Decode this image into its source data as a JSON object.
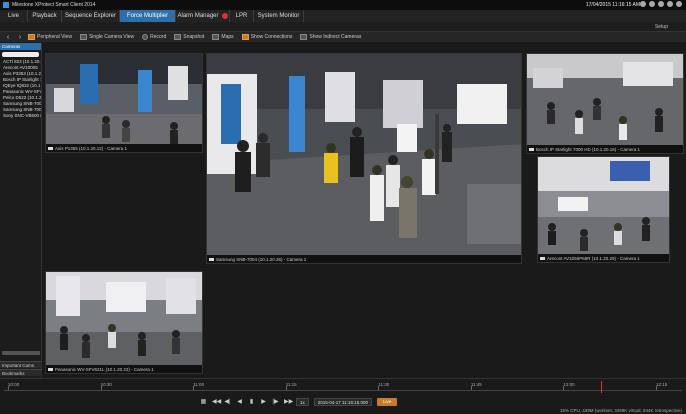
{
  "window": {
    "title": "Milestone XProtect Smart Client 2014",
    "clock": "17/04/2015 11:16:15 AM"
  },
  "tabs": [
    {
      "label": "Live",
      "active": false,
      "badge": false
    },
    {
      "label": "Playback",
      "active": false,
      "badge": false
    },
    {
      "label": "Sequence Explorer",
      "active": false,
      "badge": false
    },
    {
      "label": "Force Multiplier",
      "active": true,
      "badge": false
    },
    {
      "label": "Alarm Manager",
      "active": false,
      "badge": true
    },
    {
      "label": "LPR",
      "active": false,
      "badge": false
    },
    {
      "label": "System Monitor",
      "active": false,
      "badge": false
    }
  ],
  "subbar": {
    "setup_label": "Setup"
  },
  "toolbar": {
    "back": "‹",
    "forward": "›",
    "peripheral_view": "Peripheral View",
    "single_camera_view": "Single Camera View",
    "record": "Record",
    "snapshot": "Snapshot",
    "maps": "Maps",
    "show_connections": "Show Connections",
    "show_indirect": "Show Indirect Cameras"
  },
  "sidebar": {
    "header": "Cameras",
    "items": [
      "ACTi 823 (10.1.20.3",
      "Arecont AV10005",
      "Axis P3353 (10.1.2",
      "Bosch IP Starlight 7",
      "IQEye IQ832 (10.1",
      "Panasonic WV-SFV",
      "Pelco D522 (10.1.20",
      "Samsung SNB-7004",
      "Samsung SNB-7004",
      "Sony SNC-VB600 (1"
    ],
    "important_cams": "Important Cams",
    "bookmarks": "Bookmarks"
  },
  "cameras": {
    "top_left": "Axis P1355 (10.1.20.12) - Camera 1",
    "center": "Samsung SNB-7004 (10.1.20.36) - Camera 1",
    "top_right": "Bosch IP Starlight 7000 HD (10.1.20.16) - Camera 1",
    "mid_right": "Arecont AV3256PMIR (10.1.20.29) - Camera 1",
    "bottom_left": "Panasonic WV-SFV631L (10.1.20.23) - Camera 1"
  },
  "timeline": {
    "ticks": [
      "10:00",
      "10:30",
      "11:00",
      "11:15",
      "11:30",
      "11:45",
      "12:00",
      "12:15"
    ],
    "playhead_fraction": 0.88
  },
  "playback": {
    "speed": "1x",
    "datetime": "2015-04-17 11:16:15.000",
    "live_label": "Live"
  },
  "status": "15% CPU, 439M (workset, 3499K virtual, 944K retrospective)"
}
